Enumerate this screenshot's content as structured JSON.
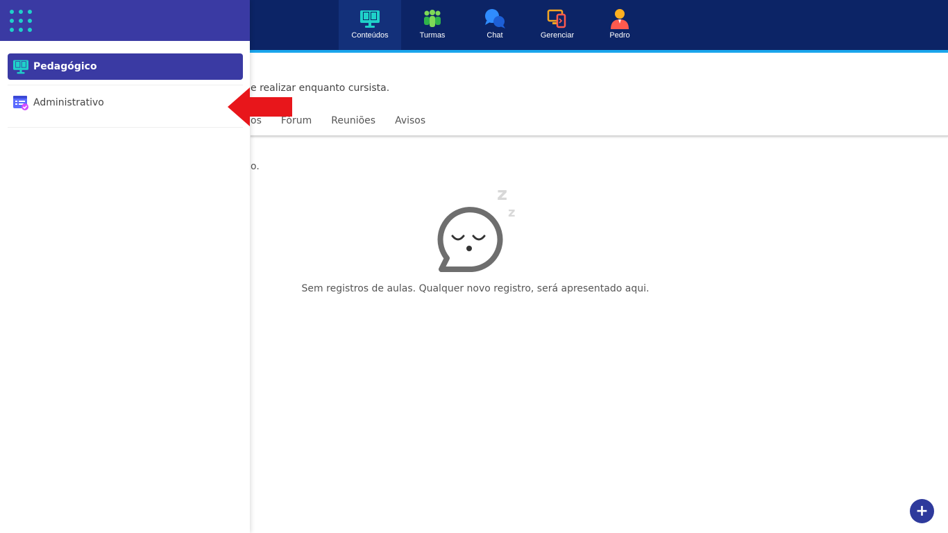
{
  "topnav": {
    "items": [
      {
        "label": "Conteúdos",
        "icon": "monitor-book-icon",
        "active": true
      },
      {
        "label": "Turmas",
        "icon": "people-group-icon",
        "active": false
      },
      {
        "label": "Chat",
        "icon": "chat-bubbles-icon",
        "active": false
      },
      {
        "label": "Gerenciar",
        "icon": "manage-devices-icon",
        "active": false
      },
      {
        "label": "Pedro",
        "icon": "user-avatar-icon",
        "active": false
      }
    ]
  },
  "main": {
    "subtitle_fragment": "e realizar enquanto cursista.",
    "tabs": [
      "os",
      "Fórum",
      "Reuniões",
      "Avisos"
    ],
    "text_fragment": "o.",
    "empty_message": "Sem registros de aulas. Qualquer novo registro, será apresentado aqui.",
    "fab_label": "+"
  },
  "drawer": {
    "items": [
      {
        "label": "Pedagógico",
        "icon": "monitor-book-icon",
        "active": true
      },
      {
        "label": "Administrativo",
        "icon": "admin-form-icon",
        "active": false
      }
    ]
  },
  "colors": {
    "topbar": "#0c2466",
    "accent_line": "#1aa5ec",
    "drawer_header": "#3a3aa3",
    "fab": "#2e3a9c",
    "arrow": "#e8161b"
  }
}
